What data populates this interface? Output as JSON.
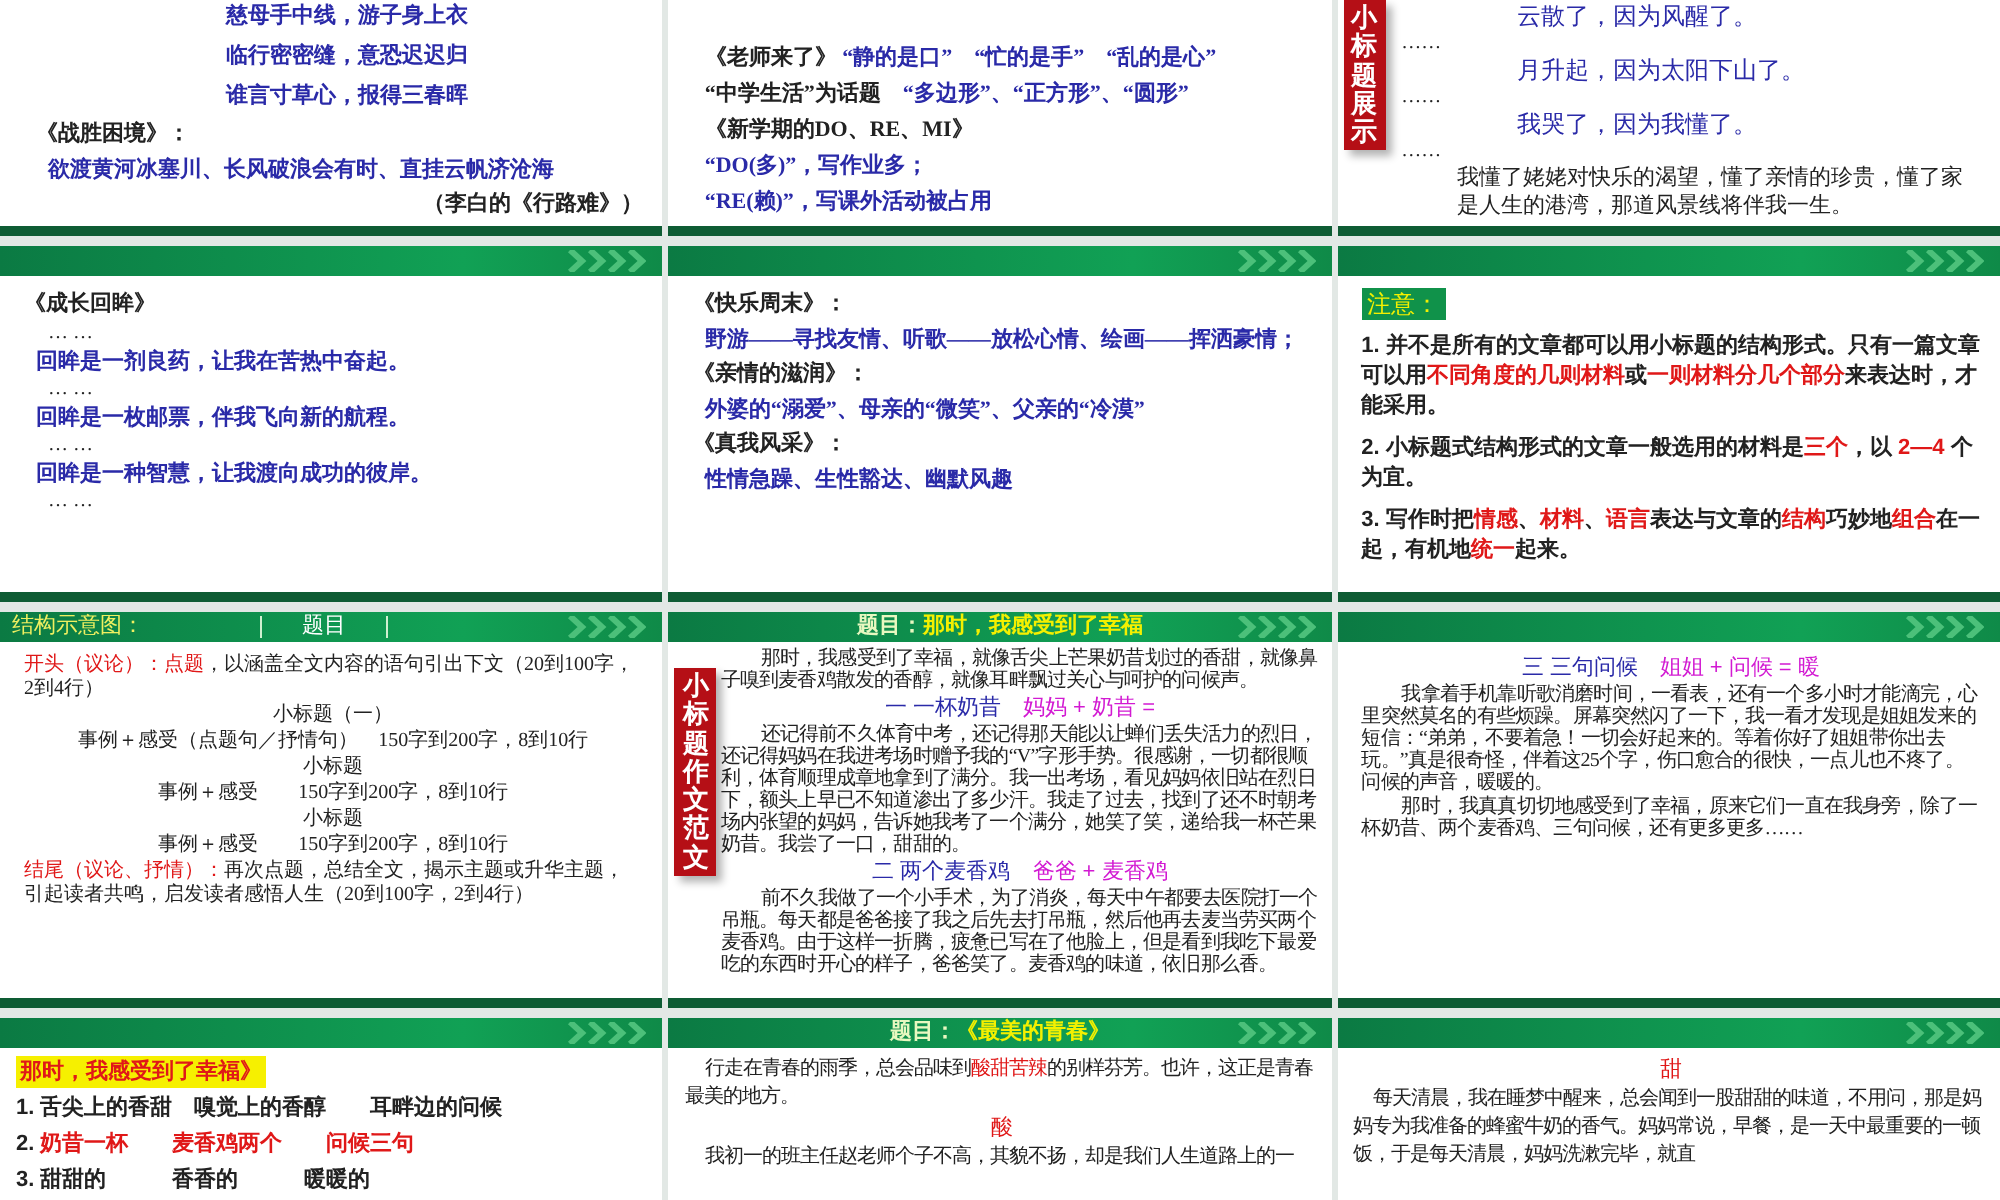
{
  "slides": [
    {
      "blocks": [
        {
          "kind": "poem",
          "parts": [
            {
              "text": "慈母手中线，游子身上衣",
              "color": "#2a2aa8"
            }
          ]
        },
        {
          "kind": "poem",
          "parts": [
            {
              "text": "临行密密缝，意恐迟迟归",
              "color": "#2a2aa8"
            }
          ]
        },
        {
          "kind": "poem",
          "parts": [
            {
              "text": "谁言寸草心，报得三春晖",
              "color": "#2a2aa8"
            }
          ]
        },
        {
          "kind": "title",
          "parts": [
            {
              "text": "《战胜困境》：",
              "color": "#222222"
            }
          ]
        },
        {
          "kind": "verse",
          "parts": [
            {
              "text": "欲渡黄河冰塞川、长风破浪会有时、直挂云帆济沧海",
              "color": "#2a2aa8"
            }
          ]
        },
        {
          "kind": "cite",
          "parts": [
            {
              "text": "（李白的《行路难》）",
              "color": "#222222"
            }
          ]
        }
      ]
    },
    {
      "blocks": [
        {
          "kind": "title",
          "parts": [
            {
              "text": "《老师来了》 ",
              "color": "#222222"
            },
            {
              "text": "“静的是口”　“忙的是手”　“乱的是心”",
              "color": "#2a2aa8"
            }
          ]
        },
        {
          "kind": "title",
          "parts": [
            {
              "text": "“中学生活”为话题　",
              "color": "#222222"
            },
            {
              "text": "“多边形”、“正方形”、“圆形”",
              "color": "#2a2aa8"
            }
          ]
        },
        {
          "kind": "title",
          "parts": [
            {
              "text": "《新学期的DO、RE、MI》",
              "color": "#222222"
            }
          ]
        },
        {
          "kind": "title",
          "parts": [
            {
              "text": "“DO(多)”，写作业多；",
              "color": "#2a2aa8"
            }
          ]
        },
        {
          "kind": "title",
          "parts": [
            {
              "text": "“RE(赖)”，写课外活动被占用",
              "color": "#2a2aa8"
            }
          ]
        }
      ]
    },
    {
      "tab": "小标题展示",
      "blocks": [
        {
          "kind": "line",
          "parts": [
            {
              "text": "云散了，因为风醒了。",
              "color": "#2a2aa8"
            }
          ]
        },
        {
          "kind": "dots",
          "parts": [
            {
              "text": "……",
              "color": "#222222"
            }
          ]
        },
        {
          "kind": "line",
          "parts": [
            {
              "text": "月升起，因为太阳下山了。",
              "color": "#2a2aa8"
            }
          ]
        },
        {
          "kind": "dots",
          "parts": [
            {
              "text": "……",
              "color": "#222222"
            }
          ]
        },
        {
          "kind": "line",
          "parts": [
            {
              "text": "我哭了，因为我懂了。",
              "color": "#2a2aa8"
            }
          ]
        },
        {
          "kind": "dots",
          "parts": [
            {
              "text": "……",
              "color": "#222222"
            }
          ]
        },
        {
          "kind": "note",
          "parts": [
            {
              "text": "我懂了姥姥对快乐的渴望，懂了亲情的珍贵，懂了家是人生的港湾，那道风景线将伴我一生。",
              "color": "#222222"
            }
          ]
        }
      ]
    },
    {
      "header": {
        "kind": "plain"
      },
      "blocks": [
        {
          "kind": "title",
          "parts": [
            {
              "text": "《成长回眸》",
              "color": "#222222"
            }
          ]
        },
        {
          "kind": "dots",
          "parts": [
            {
              "text": "… …",
              "color": "#222222"
            }
          ]
        },
        {
          "kind": "verse",
          "parts": [
            {
              "text": "回眸是一剂良药，让我在苦热中奋起。",
              "color": "#2a2aa8"
            }
          ]
        },
        {
          "kind": "dots",
          "parts": [
            {
              "text": "… …",
              "color": "#222222"
            }
          ]
        },
        {
          "kind": "verse",
          "parts": [
            {
              "text": "回眸是一枚邮票，伴我飞向新的航程。",
              "color": "#2a2aa8"
            }
          ]
        },
        {
          "kind": "dots",
          "parts": [
            {
              "text": "… …",
              "color": "#222222"
            }
          ]
        },
        {
          "kind": "verse",
          "parts": [
            {
              "text": "回眸是一种智慧，让我渡向成功的彼岸。",
              "color": "#2a2aa8"
            }
          ]
        },
        {
          "kind": "dots",
          "parts": [
            {
              "text": "… …",
              "color": "#222222"
            }
          ]
        }
      ]
    },
    {
      "header": {
        "kind": "plain"
      },
      "blocks": [
        {
          "kind": "title",
          "parts": [
            {
              "text": "《快乐周末》：",
              "color": "#222222"
            }
          ]
        },
        {
          "kind": "verse",
          "parts": [
            {
              "text": "野游——寻找友情、听歌——放松心情、绘画——挥洒豪情；",
              "color": "#2a2aa8"
            }
          ]
        },
        {
          "kind": "title",
          "parts": [
            {
              "text": "《亲情的滋润》：",
              "color": "#222222"
            }
          ]
        },
        {
          "kind": "verse",
          "parts": [
            {
              "text": "外婆的“溺爱”、母亲的“微笑”、父亲的“冷漠”",
              "color": "#2a2aa8"
            }
          ]
        },
        {
          "kind": "title",
          "parts": [
            {
              "text": "《真我风采》：",
              "color": "#222222"
            }
          ]
        },
        {
          "kind": "verse",
          "parts": [
            {
              "text": "性情急躁、生性豁达、幽默风趣",
              "color": "#2a2aa8"
            }
          ]
        }
      ]
    },
    {
      "header": {
        "kind": "plain"
      },
      "blocks": [
        {
          "kind": "badge",
          "parts": [
            {
              "text": "注意：",
              "color": "#f4f000"
            }
          ]
        },
        {
          "kind": "point",
          "parts": [
            {
              "text": "1. 并不是所有的文章都可以用小标题的结构形式。只有一篇文章可以用",
              "color": "#222222"
            },
            {
              "text": "不同角度的几则材料",
              "color": "#e01818"
            },
            {
              "text": "或",
              "color": "#222222"
            },
            {
              "text": "一则材料分几个部分",
              "color": "#e01818"
            },
            {
              "text": "来表达时，才能采用。",
              "color": "#222222"
            }
          ]
        },
        {
          "kind": "point",
          "parts": [
            {
              "text": "2. 小标题式结构形式的文章一般选用的材料是",
              "color": "#222222"
            },
            {
              "text": "三个",
              "color": "#e01818"
            },
            {
              "text": "，以 ",
              "color": "#222222"
            },
            {
              "text": "2—4",
              "color": "#e01818"
            },
            {
              "text": " 个为宜。",
              "color": "#222222"
            }
          ]
        },
        {
          "kind": "point",
          "parts": [
            {
              "text": "3. 写作时把",
              "color": "#222222"
            },
            {
              "text": "情感",
              "color": "#e01818"
            },
            {
              "text": "、",
              "color": "#222222"
            },
            {
              "text": "材料",
              "color": "#e01818"
            },
            {
              "text": "、",
              "color": "#222222"
            },
            {
              "text": "语言",
              "color": "#e01818"
            },
            {
              "text": "表达与文章的",
              "color": "#222222"
            },
            {
              "text": "结构",
              "color": "#e01818"
            },
            {
              "text": "巧妙地",
              "color": "#222222"
            },
            {
              "text": "组合",
              "color": "#e01818"
            },
            {
              "text": "在一起，有机地",
              "color": "#222222"
            },
            {
              "text": "统一",
              "color": "#e01818"
            },
            {
              "text": "起来。",
              "color": "#222222"
            }
          ]
        }
      ]
    },
    {
      "header": {
        "kind": "diagram",
        "label": "结构示意图：",
        "box": "题目"
      },
      "blocks": [
        {
          "kind": "outline",
          "parts": [
            {
              "text": "开头（议论）：",
              "color": "#e01818"
            },
            {
              "text": "点题",
              "color": "#e01818"
            },
            {
              "text": "，以涵盖全文内容的语句引出下文（20到100字，2到4行）",
              "color": "#222222"
            }
          ]
        },
        {
          "kind": "diagram",
          "parts": [
            {
              "text": "小标题（一）",
              "color": "#222222"
            }
          ]
        },
        {
          "kind": "diagram",
          "parts": [
            {
              "text": "事例＋感受（点题句／抒情句）　150字到200字，8到10行",
              "color": "#222222"
            }
          ]
        },
        {
          "kind": "diagram",
          "parts": [
            {
              "text": "小标题",
              "color": "#222222"
            }
          ]
        },
        {
          "kind": "diagram",
          "parts": [
            {
              "text": "事例＋感受　　150字到200字，8到10行",
              "color": "#222222"
            }
          ]
        },
        {
          "kind": "diagram",
          "parts": [
            {
              "text": "小标题",
              "color": "#222222"
            }
          ]
        },
        {
          "kind": "diagram",
          "parts": [
            {
              "text": "事例＋感受　　150字到200字，8到10行",
              "color": "#222222"
            }
          ]
        },
        {
          "kind": "outline",
          "parts": [
            {
              "text": "结尾（议论、抒情）：",
              "color": "#e01818"
            },
            {
              "text": "再次点题，总结全文，揭示主题或升华主题，引起读者共鸣，启发读者感悟人生（20到100字，2到4行）",
              "color": "#222222"
            }
          ]
        }
      ]
    },
    {
      "header": {
        "kind": "title",
        "label": "题目：",
        "title": "那时，我感受到了幸福"
      },
      "tab": "小标题作文范文",
      "blocks": [
        {
          "kind": "body",
          "parts": [
            {
              "text": "那时，我感受到了幸福，就像舌尖上芒果奶昔划过的香甜，就像鼻子嗅到麦香鸡散发的香醇，就像耳畔飘过关心与呵护的问候声。",
              "color": "#222222"
            }
          ]
        },
        {
          "kind": "heading",
          "parts": [
            {
              "text": "一 一杯奶昔　",
              "color": "#2a2aa8"
            },
            {
              "text": "妈妈 + 奶昔 =",
              "color": "#d21ad2"
            }
          ]
        },
        {
          "kind": "body",
          "parts": [
            {
              "text": "还记得前不久体育中考，还记得那天能以让蝉们丢失活力的烈日，还记得妈妈在我进考场时赠予我的“V”字形手势。很感谢，一切都很顺利，体育顺理成章地拿到了满分。我一出考场，看见妈妈依旧站在烈日下，额头上早已不知道渗出了多少汗。我走了过去，找到了还不时朝考场内张望的妈妈，告诉她我考了一个满分，她笑了笑，递给我一杯芒果奶昔。我尝了一口，甜甜的。",
              "color": "#222222"
            }
          ]
        },
        {
          "kind": "heading",
          "parts": [
            {
              "text": "二 两个麦香鸡　",
              "color": "#2a2aa8"
            },
            {
              "text": "爸爸 + 麦香鸡",
              "color": "#d21ad2"
            }
          ]
        },
        {
          "kind": "body",
          "parts": [
            {
              "text": "前不久我做了一个小手术，为了消炎，每天中午都要去医院打一个吊瓶。每天都是爸爸接了我之后先去打吊瓶，然后他再去麦当劳买两个麦香鸡。由于这样一折腾，疲惫已写在了他脸上，但是看到我吃下最爱吃的东西时开心的样子，爸爸笑了。麦香鸡的味道，依旧那么香。",
              "color": "#222222"
            }
          ]
        }
      ]
    },
    {
      "header": {
        "kind": "plain"
      },
      "blocks": [
        {
          "kind": "heading",
          "parts": [
            {
              "text": "三 三句问候　",
              "color": "#2a2aa8"
            },
            {
              "text": "姐姐 + 问候 = 暖",
              "color": "#d21ad2"
            }
          ]
        },
        {
          "kind": "body",
          "parts": [
            {
              "text": "我拿着手机靠听歌消磨时间，一看表，还有一个多小时才能滴完，心里突然莫名的有些烦躁。屏幕突然闪了一下，我一看才发现是姐姐发来的短信：“弟弟，不要着急！一切会好起来的。等着你好了姐姐带你出去玩。”真是很奇怪，伴着这25个字，伤口愈合的很快，一点儿也不疼了。问候的声音，暖暖的。",
              "color": "#222222"
            }
          ]
        },
        {
          "kind": "body",
          "parts": [
            {
              "text": "那时，我真真切切地感受到了幸福，原来它们一直在我身旁，除了一杯奶昔、两个麦香鸡、三句问候，还有更多更多……",
              "color": "#222222"
            }
          ]
        }
      ]
    },
    {
      "header": {
        "kind": "plain"
      },
      "blocks": [
        {
          "kind": "highlight",
          "parts": [
            {
              "text": "那时，我感受到了幸福》",
              "color": "#e01818"
            }
          ]
        },
        {
          "kind": "point",
          "parts": [
            {
              "text": "1. 舌尖上的香甜　嗅觉上的香醇　　耳畔边的问候",
              "color": "#222222"
            }
          ]
        },
        {
          "kind": "point",
          "parts": [
            {
              "text": "2. ",
              "color": "#222222"
            },
            {
              "text": "奶昔一杯　　麦香鸡两个　　问候三句",
              "color": "#e01818"
            }
          ]
        },
        {
          "kind": "point",
          "parts": [
            {
              "text": "3. 甜甜的　　　香香的　　　暖暖的",
              "color": "#222222"
            }
          ]
        }
      ]
    },
    {
      "header": {
        "kind": "title",
        "label": "题目：",
        "title": "《最美的青春》"
      },
      "blocks": [
        {
          "kind": "prose",
          "parts": [
            {
              "text": "行走在青春的雨季，总会品味到",
              "color": "#222222"
            },
            {
              "text": "酸甜苦辣",
              "color": "#e01818"
            },
            {
              "text": "的别样芬芳。也许，这正是青春最美的地方。",
              "color": "#222222"
            }
          ]
        },
        {
          "kind": "heading",
          "parts": [
            {
              "text": "酸",
              "color": "#e01818"
            }
          ]
        },
        {
          "kind": "prose",
          "parts": [
            {
              "text": "我初一的班主任赵老师个子不高，其貌不扬，却是我们人生道路上的一",
              "color": "#222222"
            }
          ]
        }
      ]
    },
    {
      "header": {
        "kind": "plain"
      },
      "blocks": [
        {
          "kind": "heading",
          "parts": [
            {
              "text": "甜",
              "color": "#e01818"
            }
          ]
        },
        {
          "kind": "prose",
          "parts": [
            {
              "text": "每天清晨，我在睡梦中醒来，总会闻到一股甜甜的味道，不用问，那是妈妈专为我准备的蜂蜜牛奶的香气。妈妈常说，早餐，是一天中最重要的一顿饭，于是每天清晨，妈妈洗漱完毕，就直",
              "color": "#222222"
            }
          ]
        }
      ]
    }
  ]
}
